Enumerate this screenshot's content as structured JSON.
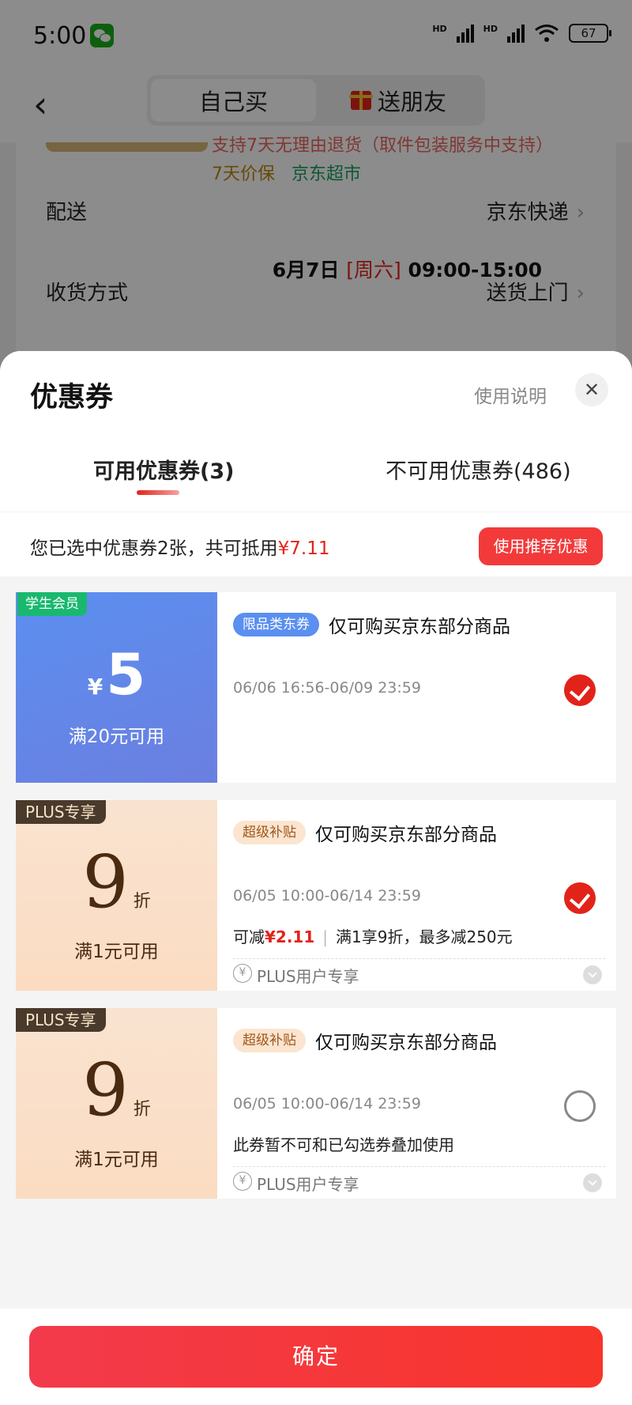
{
  "status": {
    "time": "5:00",
    "hd1": "HD",
    "hd2": "HD",
    "battery": "67"
  },
  "nav": {
    "back": "‹",
    "tab_self": "自己买",
    "tab_gift": "送朋友"
  },
  "background": {
    "partial_text": "支持7天无理由退货（取件包装服务中支持）",
    "tag_price": "7天价保",
    "tag_store": "京东超市",
    "delivery_label": "配送",
    "delivery_value": "京东快递",
    "delivery_date": "6月7日",
    "delivery_weekday": "[周六]",
    "delivery_window": "09:00-15:00",
    "receive_label": "收货方式",
    "receive_value": "送货上门",
    "chevron": "›"
  },
  "sheet": {
    "title": "优惠券",
    "usage_link": "使用说明",
    "close": "✕",
    "tab_available": "可用优惠券(3)",
    "tab_unavailable": "不可用优惠券(486)",
    "summary_prefix": "您已选中优惠券2张，共可抵用",
    "summary_amount": "¥7.11",
    "recommend_button": "使用推荐优惠"
  },
  "coupons": [
    {
      "badge": "学生会员",
      "currency": "¥",
      "amount": "5",
      "condition": "满20元可用",
      "tag": "限品类东券",
      "title": "仅可购买京东部分商品",
      "validity": "06/06 16:56-06/09 23:59",
      "selected": true
    },
    {
      "badge": "PLUS专享",
      "amount": "9",
      "unit": "折",
      "condition": "满1元可用",
      "tag": "超级补贴",
      "title": "仅可购买京东部分商品",
      "validity": "06/05 10:00-06/14 23:59",
      "detail_prefix": "可减",
      "detail_amount": "¥2.11",
      "detail_separator": "|",
      "detail_rule": "满1享9折，最多减250元",
      "foot_icon": "¥",
      "foot_text": "PLUS用户专享",
      "selected": true
    },
    {
      "badge": "PLUS专享",
      "amount": "9",
      "unit": "折",
      "condition": "满1元可用",
      "tag": "超级补贴",
      "title": "仅可购买京东部分商品",
      "validity": "06/05 10:00-06/14 23:59",
      "detail_text": "此券暂不可和已勾选券叠加使用",
      "foot_icon": "¥",
      "foot_text": "PLUS用户专享",
      "selected": false
    }
  ],
  "confirm_button": "确定",
  "colors": {
    "accent": "#e2231a",
    "student_badge": "#19b86f",
    "coupon_blue": "#5b8ff0",
    "plus_bg": "#fbdcc2"
  },
  "icons": [
    "wechat-icon",
    "wifi-icon",
    "signal-icon",
    "battery-icon",
    "back-icon",
    "gift-icon",
    "close-icon",
    "checkmark-icon",
    "yen-icon",
    "expand-icon"
  ]
}
